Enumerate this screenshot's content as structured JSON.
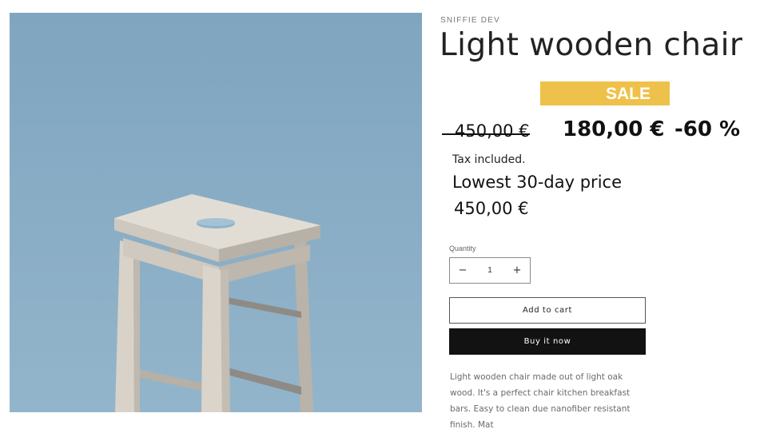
{
  "product": {
    "vendor": "SNIFFIE DEV",
    "title": "Light wooden chair",
    "sale_badge": "SALE",
    "regular_price": "450,00 €",
    "sale_price": "180,00 €",
    "discount": "-60 %",
    "tax_note": "Tax included.",
    "lowest_price_label": "Lowest 30-day price",
    "lowest_price_value": "450,00 €",
    "description": "Light wooden chair made out of light oak wood. It's a perfect chair kitchen breakfast bars. Easy to clean due nanofiber resistant finish. Mat"
  },
  "quantity": {
    "label": "Quantity",
    "value": "1",
    "decrease_symbol": "−",
    "increase_symbol": "+"
  },
  "actions": {
    "add_to_cart": "Add to cart",
    "buy_now": "Buy it now"
  },
  "media": {
    "image": "light-wooden-stool-photo",
    "background_color": "#93b5cb"
  },
  "colors": {
    "sale_badge": "#eec14a",
    "buy_button": "#121212"
  }
}
